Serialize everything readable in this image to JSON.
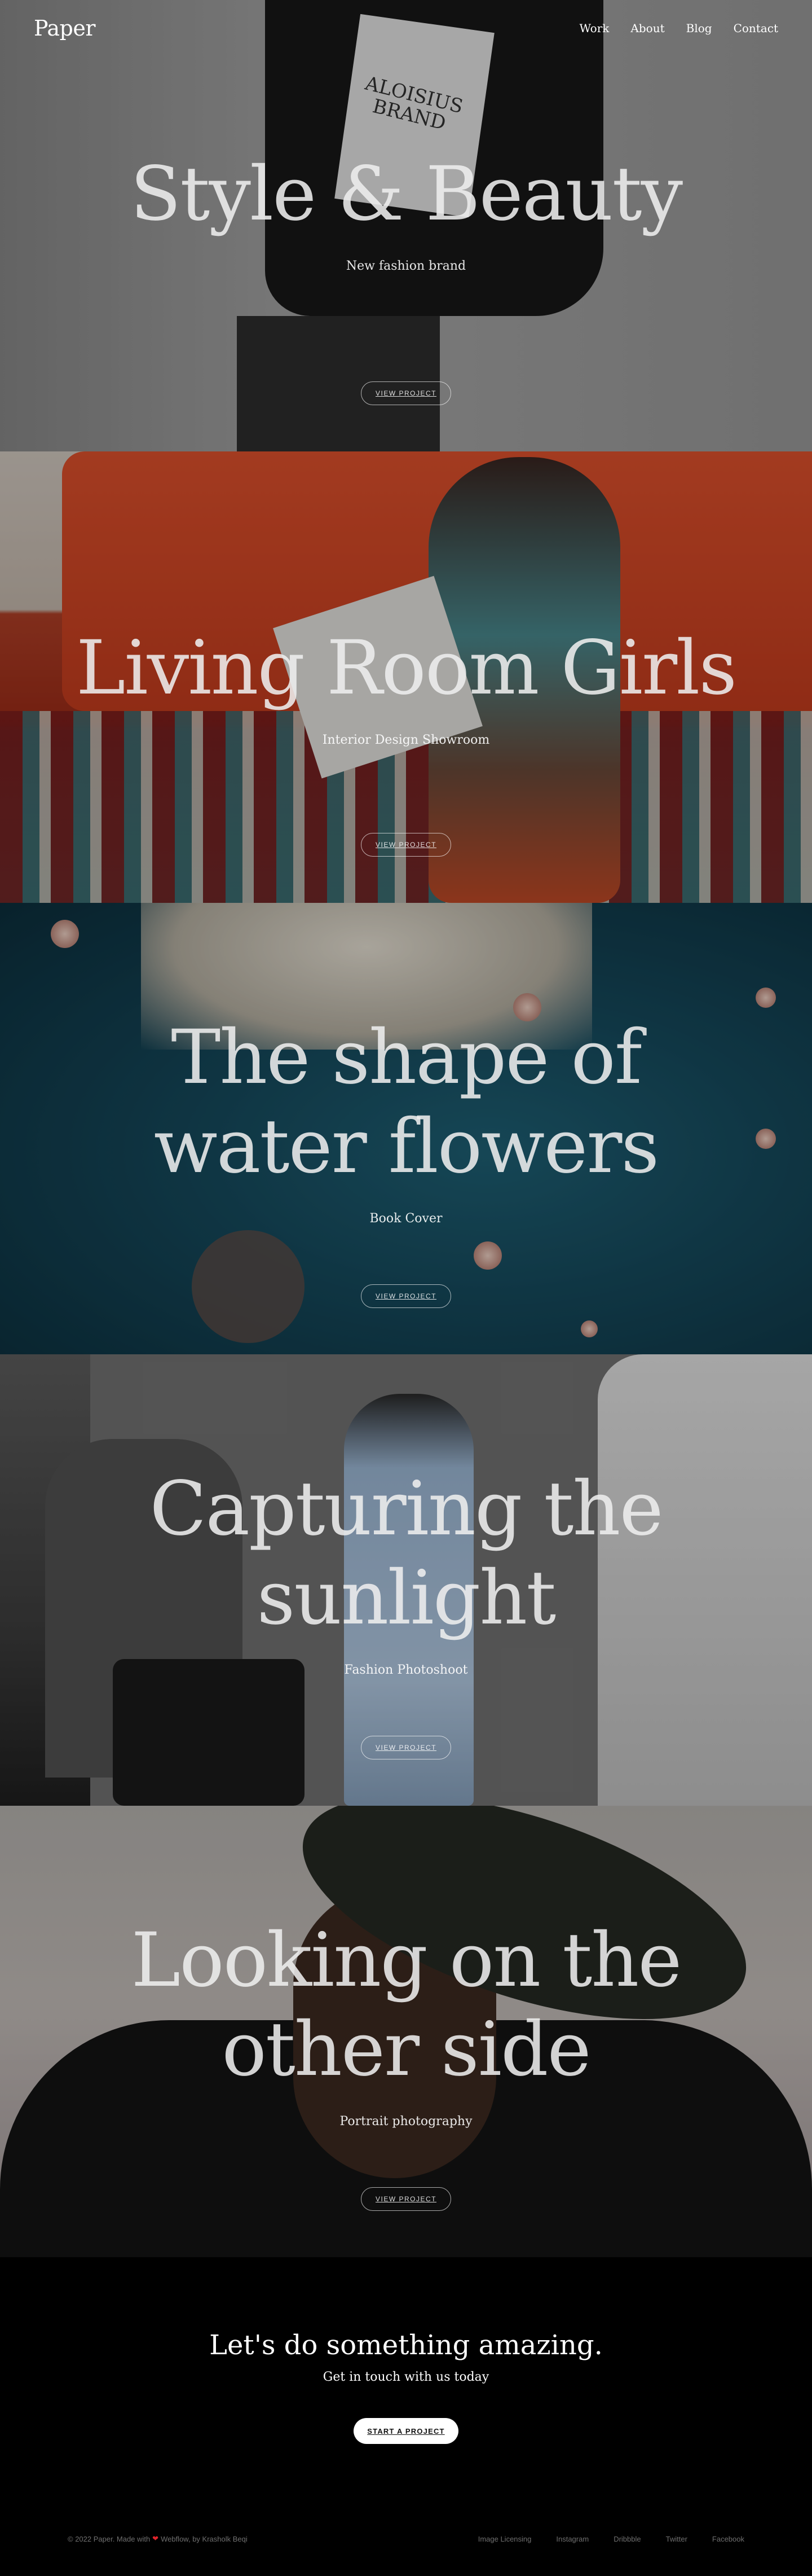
{
  "header": {
    "logo": "Paper",
    "nav": [
      {
        "label": "Work"
      },
      {
        "label": "About"
      },
      {
        "label": "Blog"
      },
      {
        "label": "Contact"
      }
    ]
  },
  "projects": [
    {
      "title": "Style & Beauty",
      "subtitle": "New fashion brand",
      "button": "VIEW PROJECT",
      "bag_text": "ALOISIUS BRAND"
    },
    {
      "title": "Living Room Girls",
      "subtitle": "Interior Design Showroom",
      "button": "VIEW PROJECT"
    },
    {
      "title": "The shape of water flowers",
      "subtitle": "Book Cover",
      "button": "VIEW PROJECT"
    },
    {
      "title": "Capturing the sunlight",
      "subtitle": "Fashion Photoshoot",
      "button": "VIEW PROJECT"
    },
    {
      "title": "Looking on the other side",
      "subtitle": "Portrait photography",
      "button": "VIEW PROJECT"
    }
  ],
  "cta": {
    "heading": "Let's do something amazing.",
    "subheading": "Get in touch with us today",
    "button": "START A PROJECT"
  },
  "footer": {
    "copyright_prefix": "© 2022 Paper. Made with",
    "heart": "❤",
    "copyright_suffix": "Webflow, by Krasholk Beqi",
    "links": [
      {
        "label": "Image Licensing"
      },
      {
        "label": "Instagram"
      },
      {
        "label": "Dribbble"
      },
      {
        "label": "Twitter"
      },
      {
        "label": "Facebook"
      }
    ]
  },
  "colors": {
    "background": "#000000",
    "heart": "#e0242b",
    "footer_text": "#6f6f6f"
  }
}
